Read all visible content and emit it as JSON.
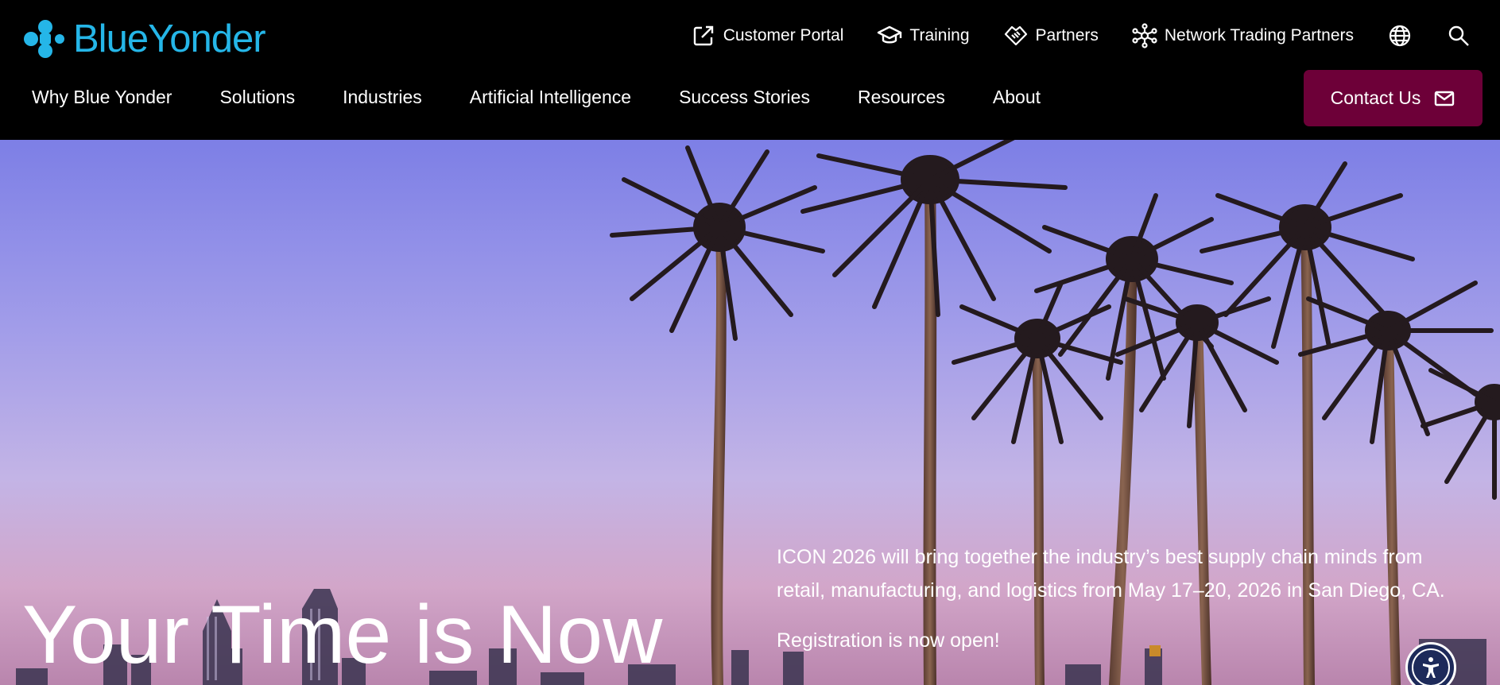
{
  "brand": {
    "name": "BlueYonder",
    "color": "#25b6e8"
  },
  "utility_nav": [
    {
      "label": "Customer Portal",
      "icon": "external-link-icon"
    },
    {
      "label": "Training",
      "icon": "graduation-cap-icon"
    },
    {
      "label": "Partners",
      "icon": "handshake-icon"
    },
    {
      "label": "Network Trading Partners",
      "icon": "network-icon"
    }
  ],
  "utility_icons": [
    "globe-icon",
    "search-icon"
  ],
  "main_nav": [
    "Why Blue Yonder",
    "Solutions",
    "Industries",
    "Artificial Intelligence",
    "Success Stories",
    "Resources",
    "About"
  ],
  "contact": {
    "label": "Contact Us",
    "icon": "mail-icon",
    "color": "#6d0038"
  },
  "hero": {
    "title": "Your Time is Now",
    "description": "ICON 2026 will bring together the industry’s best supply chain minds from retail, manufacturing, and logistics from May 17–20, 2026 in San Diego, CA.",
    "registration": "Registration is now open!"
  },
  "accessibility": {
    "icon": "accessibility-icon",
    "color": "#1d2a5a"
  }
}
